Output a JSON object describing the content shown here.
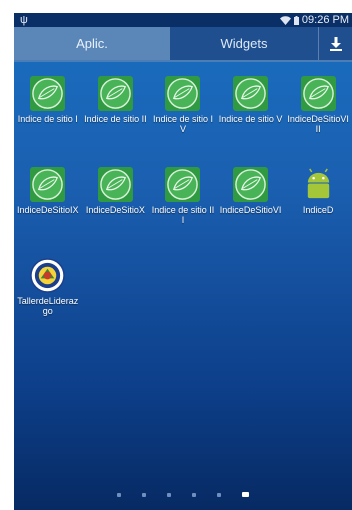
{
  "status": {
    "time": "09:26 PM",
    "left_icon": "usb-icon",
    "right_icons": [
      "wifi-icon",
      "battery-icon"
    ]
  },
  "tabs": {
    "apps": "Aplic.",
    "widgets": "Widgets",
    "download_icon": "download-icon"
  },
  "apps": [
    {
      "label": "Indice de sitio I",
      "icon": "leaf-icon"
    },
    {
      "label": "Indice de sitio II",
      "icon": "leaf-icon"
    },
    {
      "label": "Indice de sitio IV",
      "icon": "leaf-icon"
    },
    {
      "label": "Indice de sitio V",
      "icon": "leaf-icon"
    },
    {
      "label": "IndiceDeSitioVIII",
      "icon": "leaf-icon"
    },
    {
      "label": "IndiceDeSitioIX",
      "icon": "leaf-icon"
    },
    {
      "label": "IndiceDeSitioX",
      "icon": "leaf-icon"
    },
    {
      "label": "Indice de sitio III",
      "icon": "leaf-icon"
    },
    {
      "label": "IndiceDeSitioVI",
      "icon": "leaf-icon"
    },
    {
      "label": "IndiceD",
      "icon": "android-icon"
    },
    {
      "label": "TallerdeLiderazgo",
      "icon": "seal-icon"
    }
  ],
  "pager": {
    "pages": 6,
    "current": 6
  },
  "colors": {
    "leaf_green": "#3aa84a",
    "android_green": "#a4c639",
    "background_top": "#1a6fc1",
    "background_bottom": "#072a63"
  }
}
